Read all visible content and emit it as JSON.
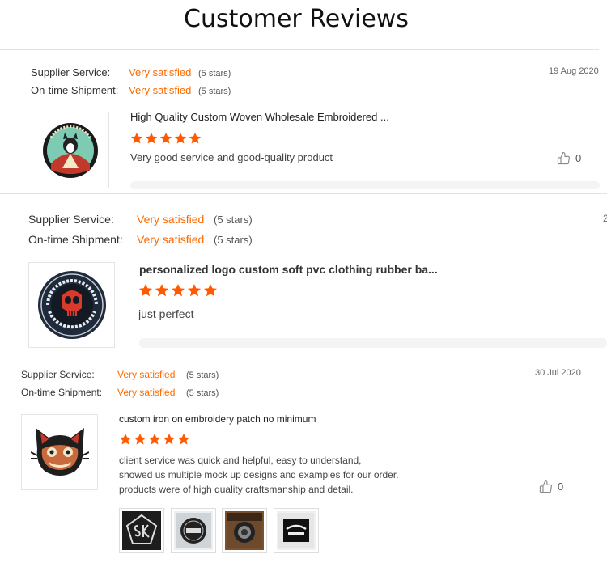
{
  "page_title": "Customer Reviews",
  "colors": {
    "accent": "#ff6a00",
    "star": "#ff5a00"
  },
  "reviews": [
    {
      "supplier_label": "Supplier Service:",
      "supplier_value": "Very satisfied",
      "supplier_stars": "(5 stars)",
      "shipment_label": "On-time Shipment:",
      "shipment_value": "Very satisfied",
      "shipment_stars": "(5 stars)",
      "date": "19 Aug 2020",
      "product_title": "High Quality Custom Woven Wholesale Embroidered ...",
      "rating": 5,
      "comment": [
        "Very good service and good-quality product"
      ],
      "likes": "0"
    },
    {
      "supplier_label": "Supplier Service:",
      "supplier_value": "Very satisfied",
      "supplier_stars": "(5 stars)",
      "shipment_label": "On-time Shipment:",
      "shipment_value": "Very satisfied",
      "shipment_stars": "(5 stars)",
      "date": "2",
      "product_title": "personalized logo custom soft pvc clothing rubber ba...",
      "rating": 5,
      "comment": [
        "just perfect"
      ]
    },
    {
      "supplier_label": "Supplier Service:",
      "supplier_value": "Very satisfied",
      "supplier_stars": "(5 stars)",
      "shipment_label": "On-time Shipment:",
      "shipment_value": "Very satisfied",
      "shipment_stars": "(5 stars)",
      "date": "30 Jul 2020",
      "product_title": "custom iron on embroidery patch no minimum",
      "rating": 5,
      "comment": [
        "client service was quick and helpful, easy to understand,",
        "showed us multiple mock up designs and examples for our order.",
        "products were of high quality craftsmanship and detail."
      ],
      "likes": "0",
      "attachments": [
        "attachment-1",
        "attachment-2",
        "attachment-3",
        "attachment-4"
      ]
    }
  ]
}
